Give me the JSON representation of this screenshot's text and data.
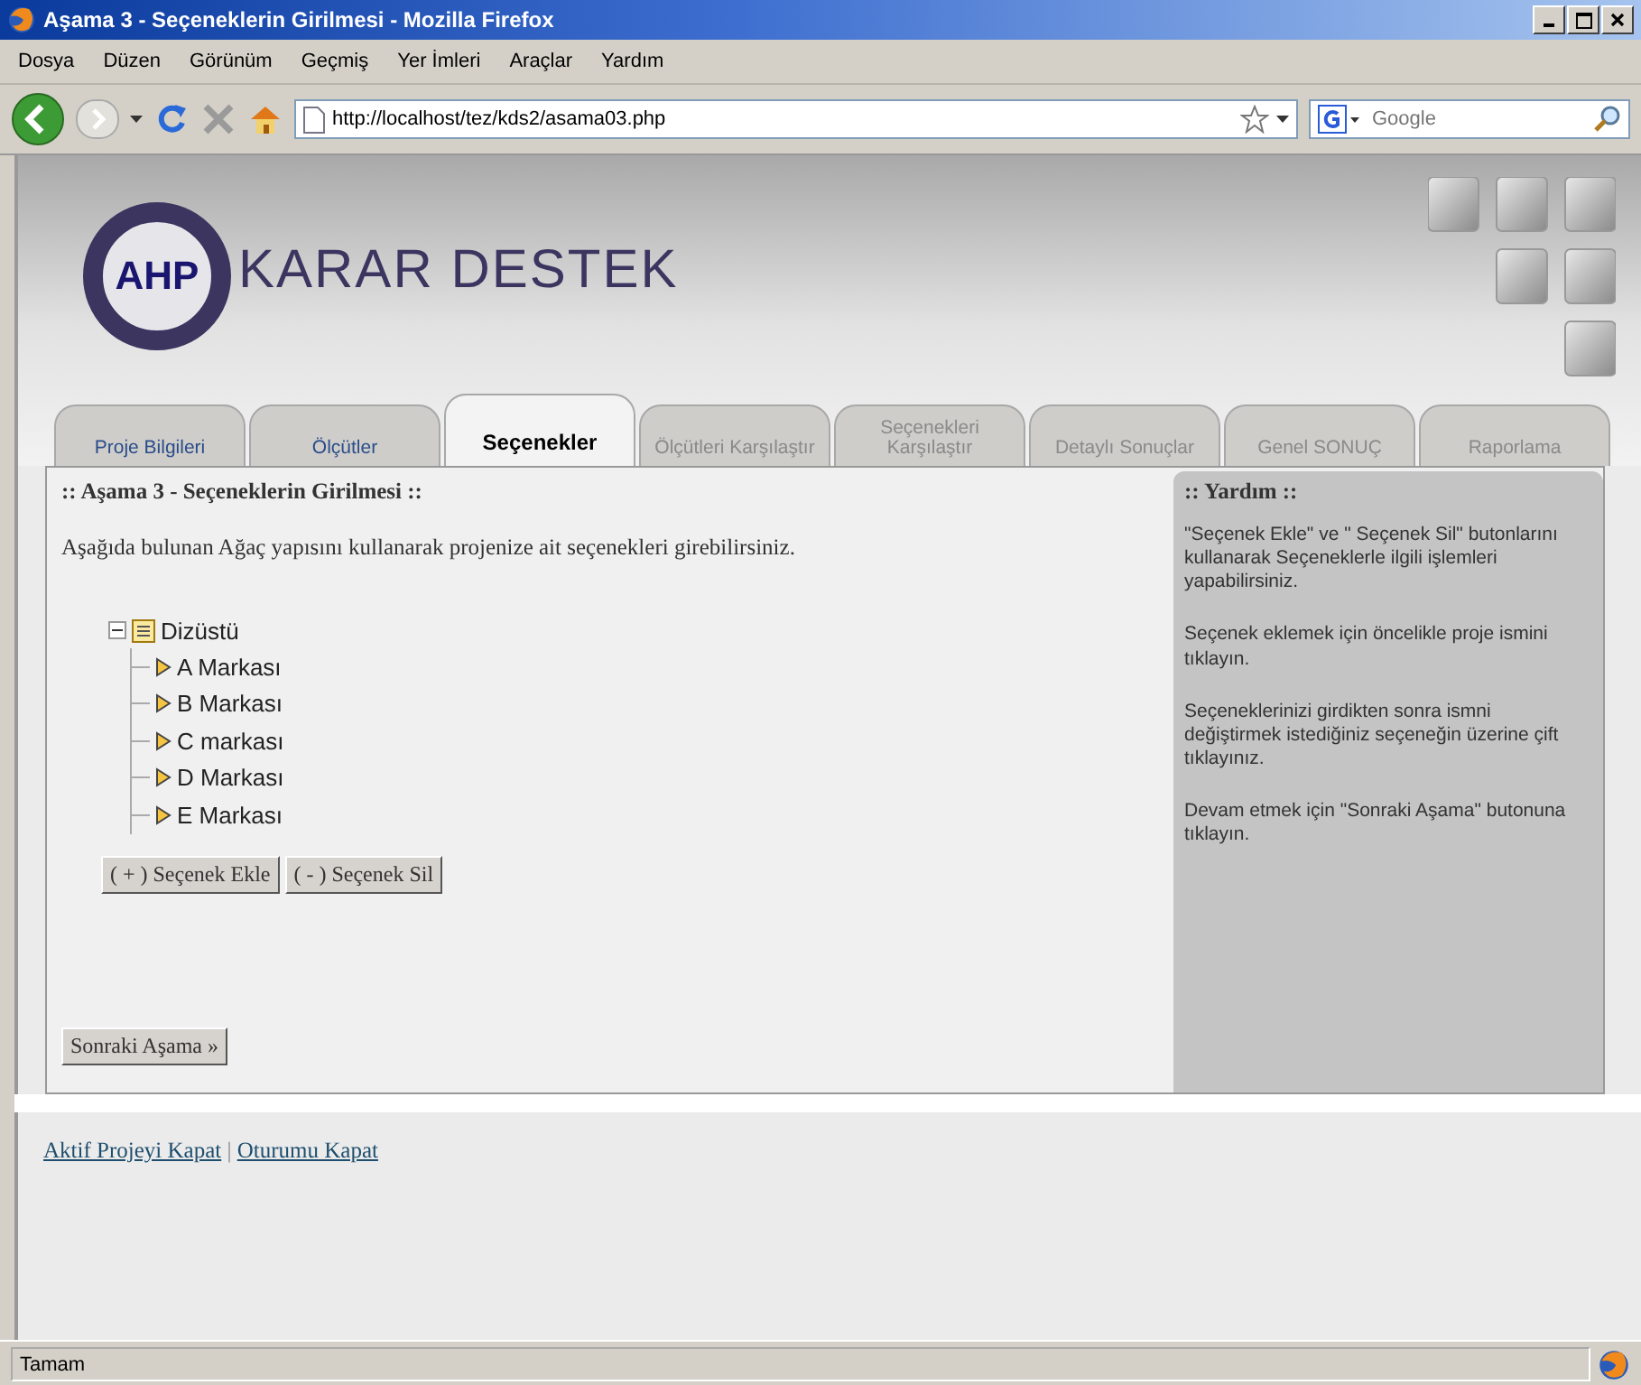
{
  "window": {
    "title": "Aşama 3 - Seçeneklerin Girilmesi - Mozilla Firefox"
  },
  "menu": [
    "Dosya",
    "Düzen",
    "Görünüm",
    "Geçmiş",
    "Yer İmleri",
    "Araçlar",
    "Yardım"
  ],
  "toolbar": {
    "url": "http://localhost/tez/kds2/asama03.php",
    "search_placeholder": "Google"
  },
  "logo": {
    "badge": "AHP",
    "title": "KARAR DESTEK"
  },
  "tabs": [
    {
      "label": "Proje Bilgileri",
      "selected": false,
      "disabled": false
    },
    {
      "label": "Ölçütler",
      "selected": false,
      "disabled": false
    },
    {
      "label": "Seçenekler",
      "selected": true,
      "disabled": false
    },
    {
      "label": "Ölçütleri Karşılaştır",
      "selected": false,
      "disabled": true
    },
    {
      "label": "Seçenekleri Karşılaştır",
      "selected": false,
      "disabled": true
    },
    {
      "label": "Detaylı Sonuçlar",
      "selected": false,
      "disabled": true
    },
    {
      "label": "Genel SONUÇ",
      "selected": false,
      "disabled": true
    },
    {
      "label": "Raporlama",
      "selected": false,
      "disabled": true
    }
  ],
  "main": {
    "heading": ":: Aşama 3 - Seçeneklerin Girilmesi ::",
    "intro": "Aşağıda bulunan Ağaç yapısını kullanarak projenize ait seçenekleri girebilirsiniz.",
    "tree": [
      {
        "label": "Dizüstü",
        "expanded": true,
        "children": [
          {
            "label": "A Markası"
          },
          {
            "label": "B Markası"
          },
          {
            "label": "C markası"
          },
          {
            "label": "D Markası"
          },
          {
            "label": "E Markası"
          }
        ]
      }
    ],
    "buttons": [
      "( + ) Seçenek Ekle",
      "( - ) Seçenek Sil"
    ],
    "next_button": "Sonraki Aşama »"
  },
  "help": {
    "heading": ":: Yardım ::",
    "paragraphs": [
      "\"Seçenek Ekle\" ve \" Seçenek Sil\" butonlarını kullanarak Seçeneklerle ilgili işlemleri yapabilirsiniz.",
      "Seçenek eklemek için öncelikle proje ismini tıklayın.",
      "Seçeneklerinizi girdikten sonra ismni değiştirmek istediğiniz seçeneğin üzerine çift tıklayınız.",
      "Devam etmek için \"Sonraki Aşama\" butonuna tıklayın."
    ]
  },
  "footer_links": [
    "Aktif Projeyi Kapat",
    "Oturumu Kapat"
  ],
  "footer_separator": "|",
  "status_bar": "Tamam"
}
